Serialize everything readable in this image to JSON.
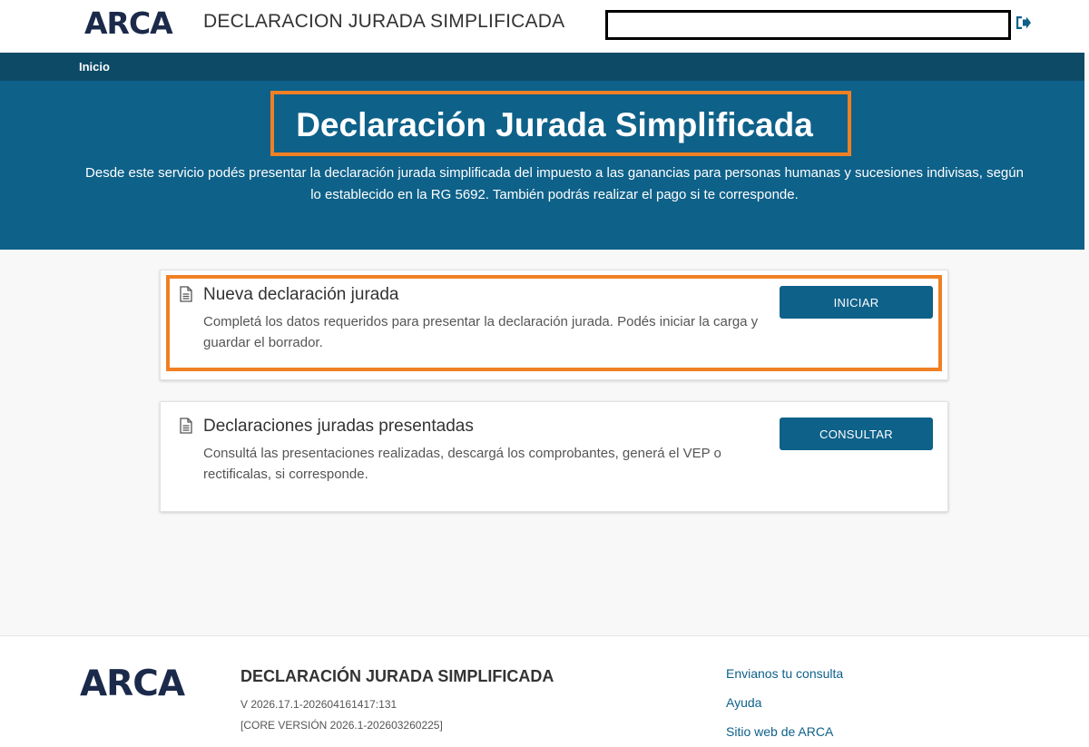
{
  "header": {
    "logo": "ARCA",
    "app_title": "DECLARACION JURADA SIMPLIFICADA",
    "user_box": ""
  },
  "breadcrumb": {
    "home": "Inicio"
  },
  "hero": {
    "title": "Declaración Jurada Simplificada",
    "description_line1": "Desde este servicio podés presentar la declaración jurada simplificada del impuesto a las ganancias para personas humanas y sucesiones indivisas, según",
    "description_line2": "lo establecido en la RG 5692. También podrás realizar el pago si te corresponde."
  },
  "cards": [
    {
      "title": "Nueva declaración jurada",
      "text_line1": "Completá los datos requeridos para presentar la declaración jurada. Podés iniciar la carga y",
      "text_line2": "guardar el borrador.",
      "button": "INICIAR",
      "icon": "document-icon"
    },
    {
      "title": "Declaraciones juradas presentadas",
      "text_line1": "Consultá las presentaciones realizadas, descargá los comprobantes, generá el VEP o",
      "text_line2": "rectificalas, si corresponde.",
      "button": "CONSULTAR",
      "icon": "document-icon"
    }
  ],
  "footer": {
    "logo": "ARCA",
    "title": "DECLARACIÓN JURADA SIMPLIFICADA",
    "version": "V 2026.17.1-202604161417:131",
    "core_version": "[CORE VERSIÓN 2026.1-202603260225]",
    "links": [
      "Envianos tu consulta",
      "Ayuda",
      "Sitio web de ARCA"
    ]
  },
  "colors": {
    "brand_dark": "#0c4a66",
    "brand": "#0e6189",
    "highlight": "#f08024",
    "logo": "#1b2a4a"
  }
}
